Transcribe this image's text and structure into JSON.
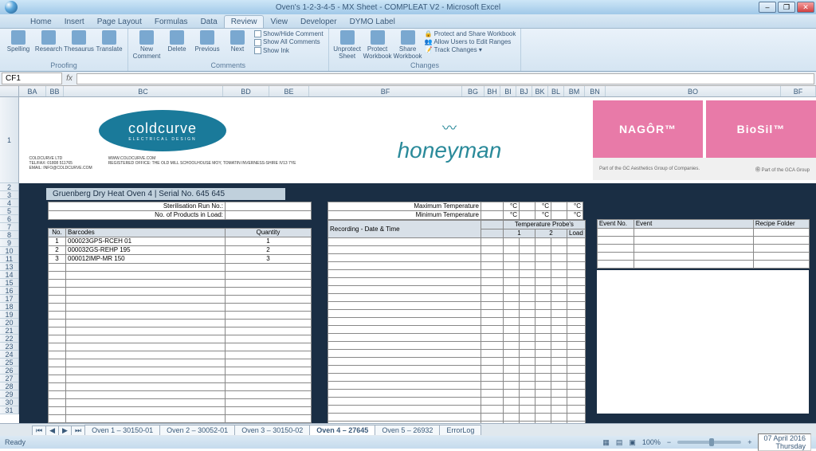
{
  "window": {
    "title": "Oven's 1-2-3-4-5 - MX Sheet - COMPLEAT V2 - Microsoft Excel"
  },
  "ribbon": {
    "tabs": [
      "Home",
      "Insert",
      "Page Layout",
      "Formulas",
      "Data",
      "Review",
      "View",
      "Developer",
      "DYMO Label"
    ],
    "active": "Review",
    "proofing": {
      "label": "Proofing",
      "spelling": "Spelling",
      "research": "Research",
      "thesaurus": "Thesaurus",
      "translate": "Translate"
    },
    "comments": {
      "label": "Comments",
      "new": "New Comment",
      "delete": "Delete",
      "previous": "Previous",
      "next": "Next",
      "showhide": "Show/Hide Comment",
      "showall": "Show All Comments",
      "showink": "Show Ink"
    },
    "changes": {
      "label": "Changes",
      "unprotect": "Unprotect Sheet",
      "protectwb": "Protect Workbook",
      "sharewb": "Share Workbook",
      "protectshare": "Protect and Share Workbook",
      "allowedit": "Allow Users to Edit Ranges",
      "track": "Track Changes"
    }
  },
  "formula": {
    "cell": "CF1"
  },
  "cols": [
    "BA",
    "BB",
    "BC",
    "BD",
    "BE",
    "BF",
    "BG",
    "BH",
    "BI",
    "BJ",
    "BK",
    "BL",
    "BM",
    "BN",
    "BO",
    "BF"
  ],
  "sheet": {
    "title": "Gruenberg Dry Heat Oven 4  |  Serial No. 645 645",
    "meta": {
      "runno": "Sterilisation Run No.:",
      "products": "No. of Products in Load:"
    },
    "barcodes": {
      "h_no": "No.",
      "h_bc": "Barcodes",
      "h_qty": "Quantity",
      "rows": [
        {
          "no": "1",
          "bc": "000023GPS-RCEH 01",
          "qty": "1"
        },
        {
          "no": "2",
          "bc": "000032GS-REHP 195",
          "qty": "2"
        },
        {
          "no": "3",
          "bc": "000012IMP-MR 150",
          "qty": "3"
        }
      ]
    },
    "temp": {
      "max": "Maximum Temperature",
      "min": "Minimum Temperature",
      "degc": "°C"
    },
    "recording": {
      "h": "Recording - Date & Time",
      "probes": "Temperature Probe's",
      "p1": "1",
      "p2": "2",
      "load": "Load"
    },
    "events": {
      "h_no": "Event No.",
      "h_ev": "Event",
      "h_rf": "Recipe Folder"
    }
  },
  "logos": {
    "coldcurve": {
      "name": "coldcurve",
      "sub": "ELECTRICAL DESIGN",
      "company": "COLDCURVE LTD",
      "tel": "TEL/FAX: 01808 511765",
      "email": "EMAIL: INFO@COLDCURVE.COM",
      "web": "WWW.COLDCURVE.COM",
      "addr": "REGISTERED OFFICE: THE OLD MILL SCHOOLHOUSE MOY, TOMATIN INVERNESS-SHIRE IV13 7YE"
    },
    "honeyman": "honeyman",
    "nagor": "NAGÔR™",
    "biosil": "BioSil™",
    "gca": {
      "left": "Part of the GC Aesthetics Group of Companies.",
      "right": "Part of the GCA Group"
    }
  },
  "tabs": {
    "items": [
      "Oven 1 – 30150-01",
      "Oven 2 – 30052-01",
      "Oven 3 – 30150-02",
      "Oven 4 – 27645",
      "Oven 5 – 26932",
      "ErrorLog"
    ],
    "active": 3
  },
  "status": {
    "ready": "Ready",
    "zoom": "100%",
    "date": "07 April 2016",
    "day": "Thursday"
  }
}
